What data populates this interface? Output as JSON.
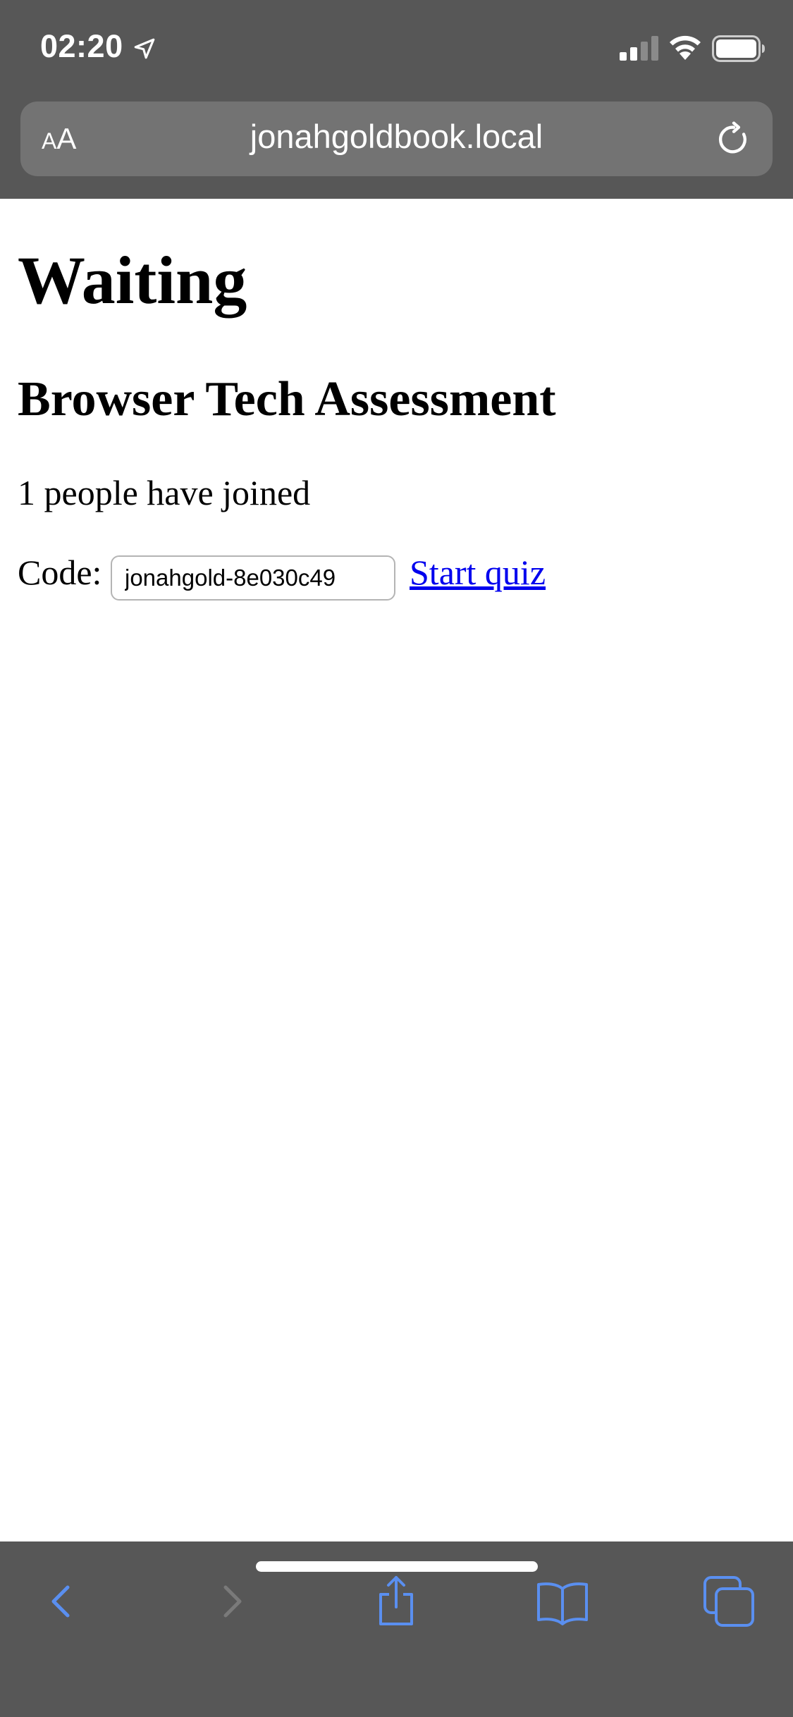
{
  "status_bar": {
    "time": "02:20"
  },
  "browser": {
    "text_size_small": "A",
    "text_size_large": "A",
    "url": "jonahgoldbook.local"
  },
  "page": {
    "title": "Waiting",
    "quiz_name": "Browser Tech Assessment",
    "joined_text": "1 people have joined",
    "code_label": "Code:",
    "code_value": "jonahgold-8e030c49",
    "start_link": "Start quiz"
  },
  "toolbar": {
    "icons": [
      "back-icon",
      "forward-icon",
      "share-icon",
      "bookmarks-icon",
      "tabs-icon"
    ]
  },
  "colors": {
    "chrome_bg": "#575757",
    "address_bar_bg": "#737373",
    "toolbar_icon": "#5a8ff0",
    "toolbar_icon_disabled": "#7a7a7a",
    "link": "#0000ee"
  }
}
